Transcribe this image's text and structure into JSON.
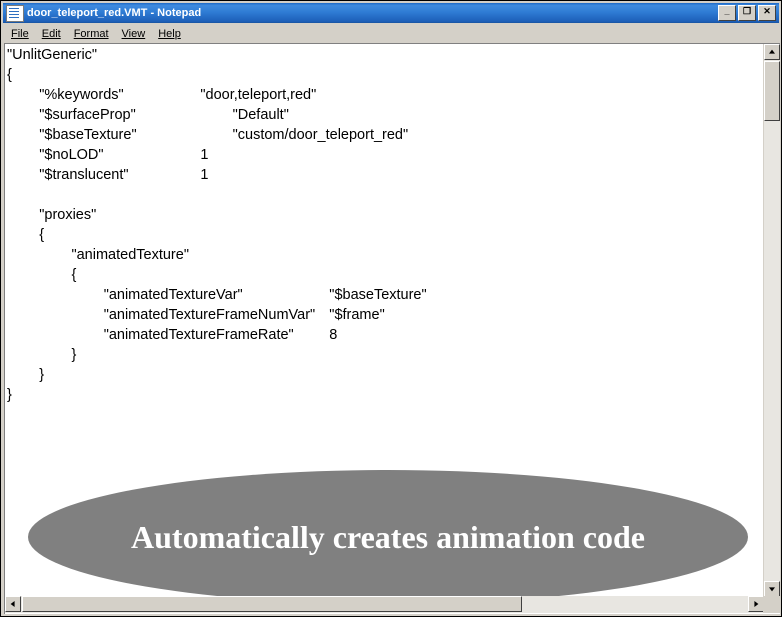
{
  "window": {
    "title": "door_teleport_red.VMT - Notepad",
    "icon": "notepad-icon",
    "buttons": {
      "minimize": "_",
      "maximize": "□",
      "close": "✕"
    }
  },
  "menu": {
    "items": [
      {
        "label": "File"
      },
      {
        "label": "Edit"
      },
      {
        "label": "Format"
      },
      {
        "label": "View"
      },
      {
        "label": "Help"
      }
    ]
  },
  "editor": {
    "content": "\"UnlitGeneric\"\n{\n\t\"%keywords\"\t\t\t\"door,teleport,red\"\n\t\"$surfaceProp\"\t\t\t\"Default\"\n\t\"$baseTexture\"\t\t\t\"custom/door_teleport_red\"\n\t\"$noLOD\"\t\t\t1\n\t\"$translucent\"\t\t\t1\n\n\t\"proxies\"\n\t{\n\t\t\"animatedTexture\"\n\t\t{\n\t\t\t\"animatedTextureVar\"\t\t\t\"$baseTexture\"\n\t\t\t\"animatedTextureFrameNumVar\"\t\"$frame\"\n\t\t\t\"animatedTextureFrameRate\"\t\t8\n\t\t}\n\t}\n}"
  },
  "annotation": {
    "text": "Automatically creates animation code",
    "fill_color": "#808080",
    "text_color": "#ffffff"
  },
  "scrollbars": {
    "vertical": {
      "up": "scroll-up-arrow",
      "down": "scroll-down-arrow"
    },
    "horizontal": {
      "left": "scroll-left-arrow",
      "right": "scroll-right-arrow"
    }
  }
}
